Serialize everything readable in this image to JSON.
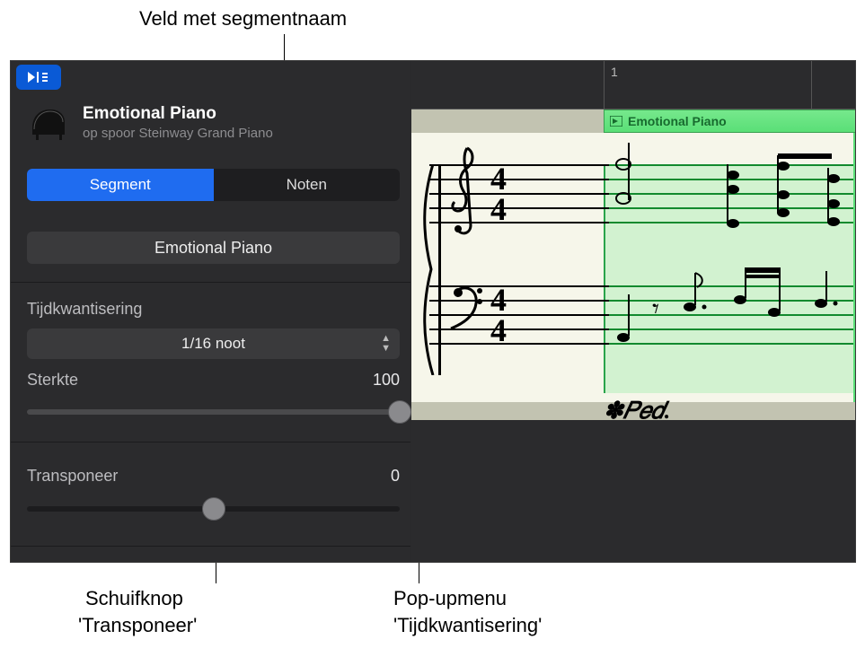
{
  "callouts": {
    "segment_name_field": "Veld met segmentnaam",
    "transpose_slider_1": "Schuifknop",
    "transpose_slider_2": "'Transponeer'",
    "quantize_popup_1": "Pop-upmenu",
    "quantize_popup_2": "'Tijdkwantisering'"
  },
  "header": {
    "segment_title": "Emotional Piano",
    "segment_subtitle": "op spoor Steinway Grand Piano"
  },
  "tabs": {
    "segment": "Segment",
    "notes": "Noten"
  },
  "name_field": {
    "value": "Emotional Piano"
  },
  "quantize": {
    "label": "Tijdkwantisering",
    "value": "1/16 noot"
  },
  "strength": {
    "label": "Sterkte",
    "value": "100"
  },
  "transpose": {
    "label": "Transponeer",
    "value": "0"
  },
  "ruler": {
    "marker_1": "1"
  },
  "region": {
    "name": "Emotional Piano"
  },
  "pedal": {
    "mark": "✽𝑃𝑒𝑑."
  },
  "colors": {
    "accent_blue": "#1f6cf0",
    "panel_dark": "#2b2b2d",
    "region_green": "#5adf77"
  },
  "chart_data": {
    "type": "notation",
    "time_signature": "4/4",
    "clefs": [
      "treble",
      "bass"
    ],
    "pedal_start_bar": 1
  }
}
